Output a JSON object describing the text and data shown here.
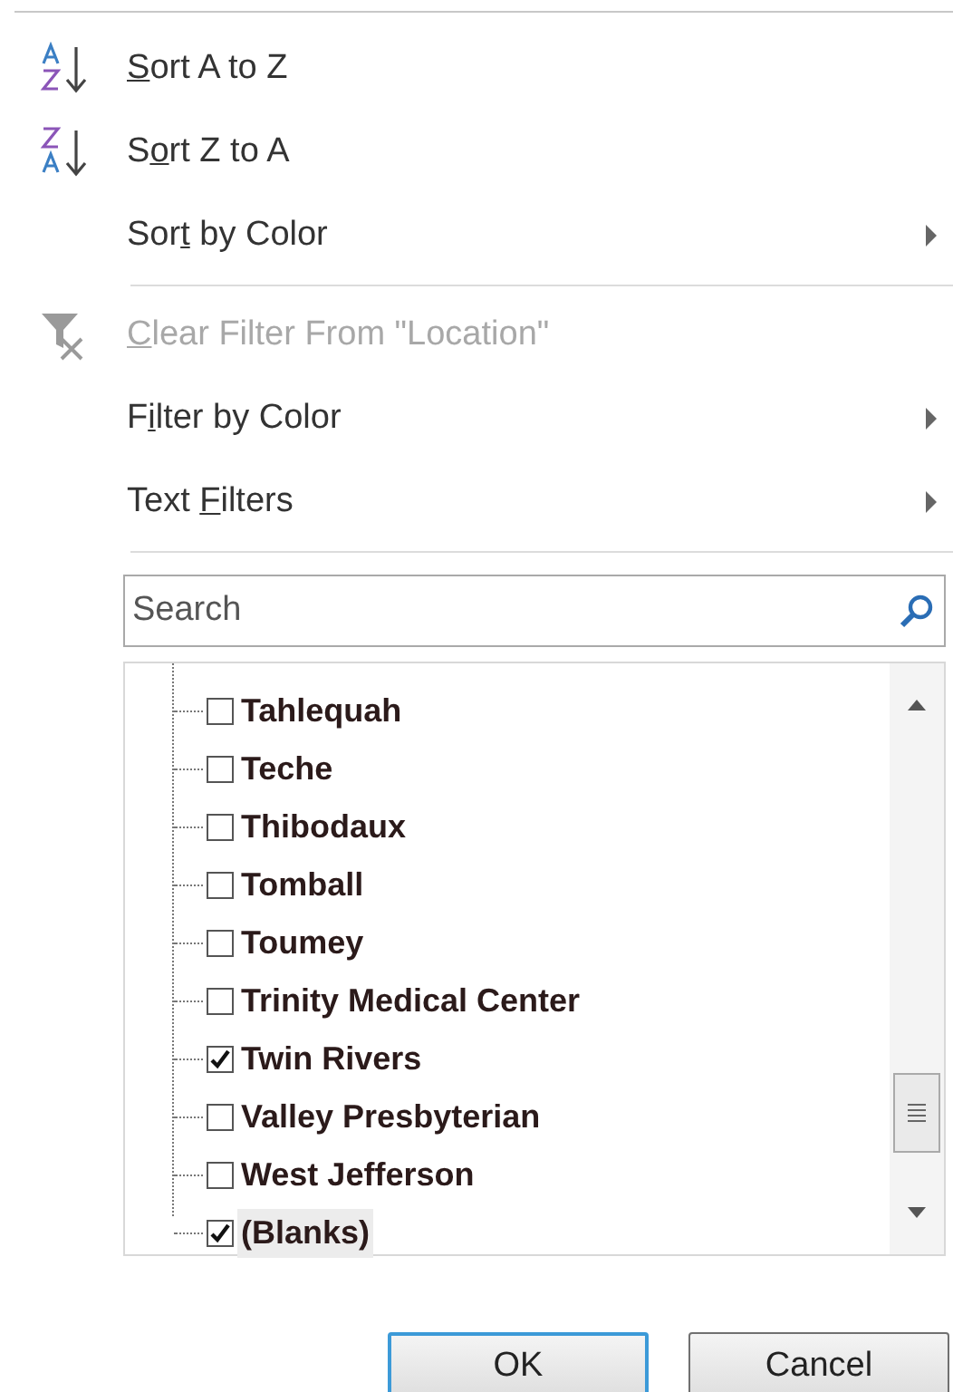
{
  "menu": [
    {
      "kind": "sort_az",
      "access_key": "S",
      "label_end": "ort A to Z",
      "submenu": false,
      "disabled": false
    },
    {
      "kind": "sort_za",
      "label_start": "S",
      "access_key": "o",
      "label_end": "rt Z to A",
      "submenu": false,
      "disabled": false
    },
    {
      "kind": "none",
      "label_start": "Sor",
      "access_key": "t",
      "label_end": " by Color",
      "submenu": true,
      "disabled": false
    },
    {
      "kind": "separator"
    },
    {
      "kind": "clear_filter",
      "access_key": "C",
      "label_end": "lear Filter From \"Location\"",
      "submenu": false,
      "disabled": true
    },
    {
      "kind": "none",
      "label_start": "F",
      "access_key": "i",
      "label_end": "lter by Color",
      "submenu": true,
      "disabled": false
    },
    {
      "kind": "none",
      "label_start": "Text ",
      "access_key": "F",
      "label_end": "ilters",
      "submenu": true,
      "disabled": false
    },
    {
      "kind": "separator"
    }
  ],
  "search": {
    "placeholder": "Search"
  },
  "values": [
    {
      "label": "Tahlequah",
      "checked": false,
      "selected": false
    },
    {
      "label": "Teche",
      "checked": false,
      "selected": false
    },
    {
      "label": "Thibodaux",
      "checked": false,
      "selected": false
    },
    {
      "label": "Tomball",
      "checked": false,
      "selected": false
    },
    {
      "label": "Toumey",
      "checked": false,
      "selected": false
    },
    {
      "label": "Trinity Medical Center",
      "checked": false,
      "selected": false
    },
    {
      "label": "Twin Rivers",
      "checked": true,
      "selected": false
    },
    {
      "label": "Valley Presbyterian",
      "checked": false,
      "selected": false
    },
    {
      "label": "West Jefferson",
      "checked": false,
      "selected": false
    },
    {
      "label": "(Blanks)",
      "checked": true,
      "selected": true
    }
  ],
  "buttons": [
    {
      "label": "OK",
      "kind": "default"
    },
    {
      "label": "Cancel",
      "kind": "normal"
    }
  ]
}
